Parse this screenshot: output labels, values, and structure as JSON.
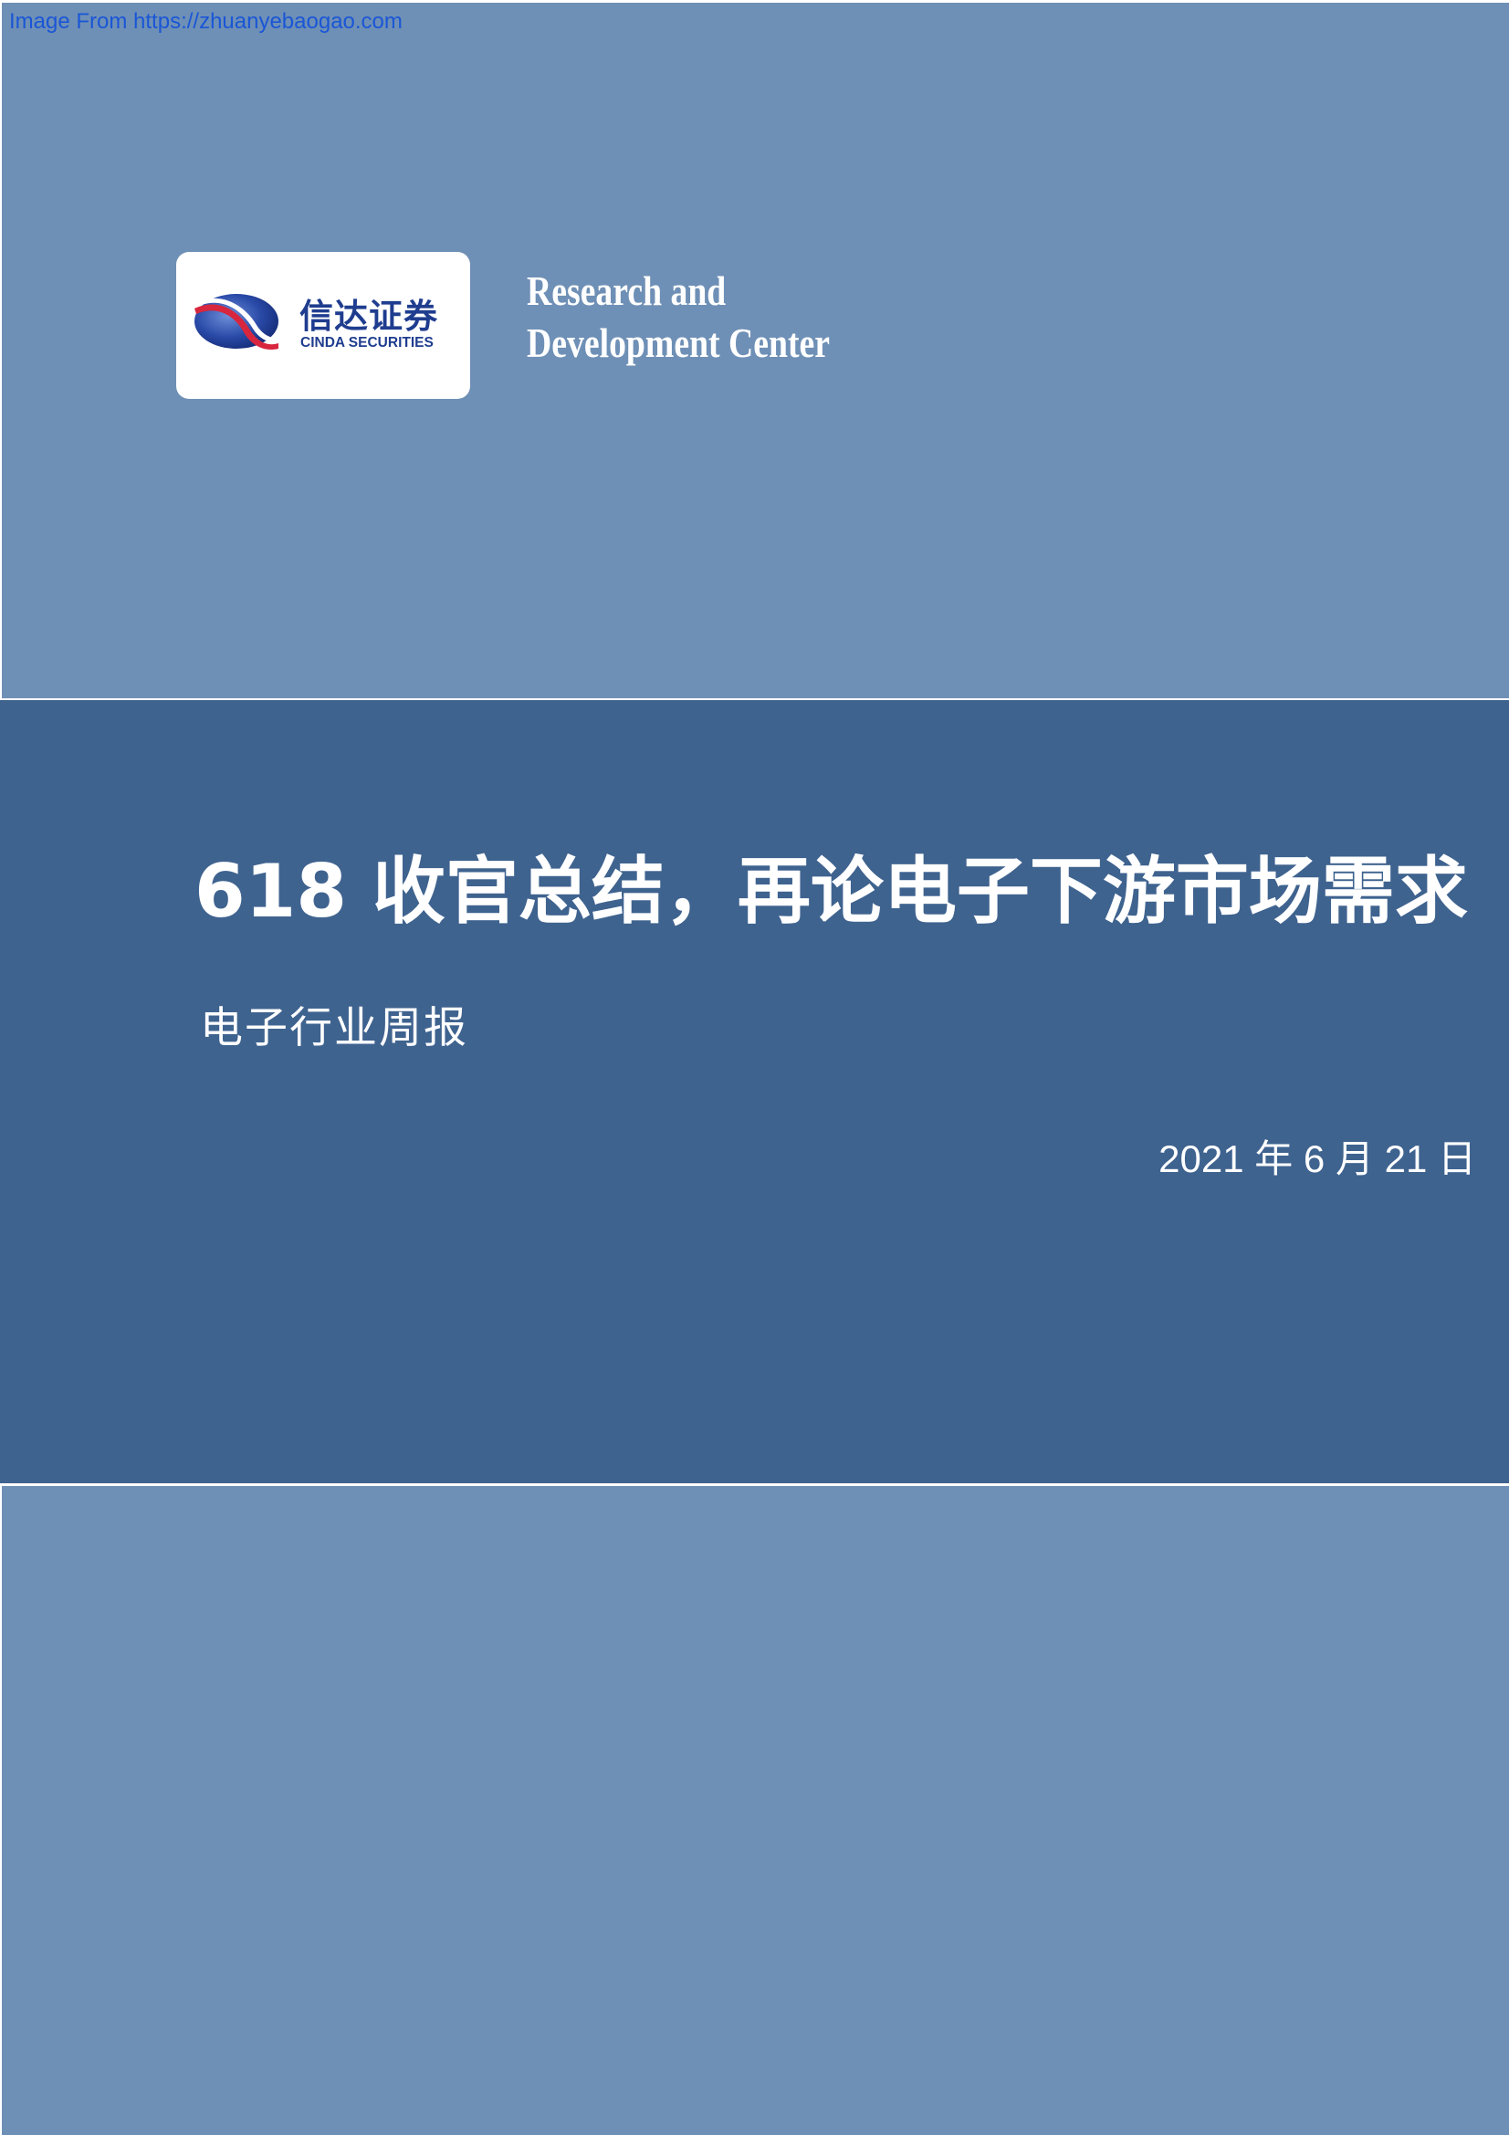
{
  "source_link": "Image From https://zhuanyebaogao.com",
  "logo": {
    "name_cn": "信达证券",
    "name_en": "CINDA SECURITIES",
    "mark_colors": {
      "blue": "#1f3d8f",
      "red": "#d7263d"
    }
  },
  "research_center": {
    "line1": "Research and",
    "line2": "Development Center"
  },
  "report": {
    "title": "618 收官总结，再论电子下游市场需求",
    "subtitle": "电子行业周报",
    "date": "2021 年 6 月 21 日"
  },
  "colors": {
    "light_band": "#6f90b6",
    "dark_band": "#3f638f",
    "text": "#ffffff"
  }
}
